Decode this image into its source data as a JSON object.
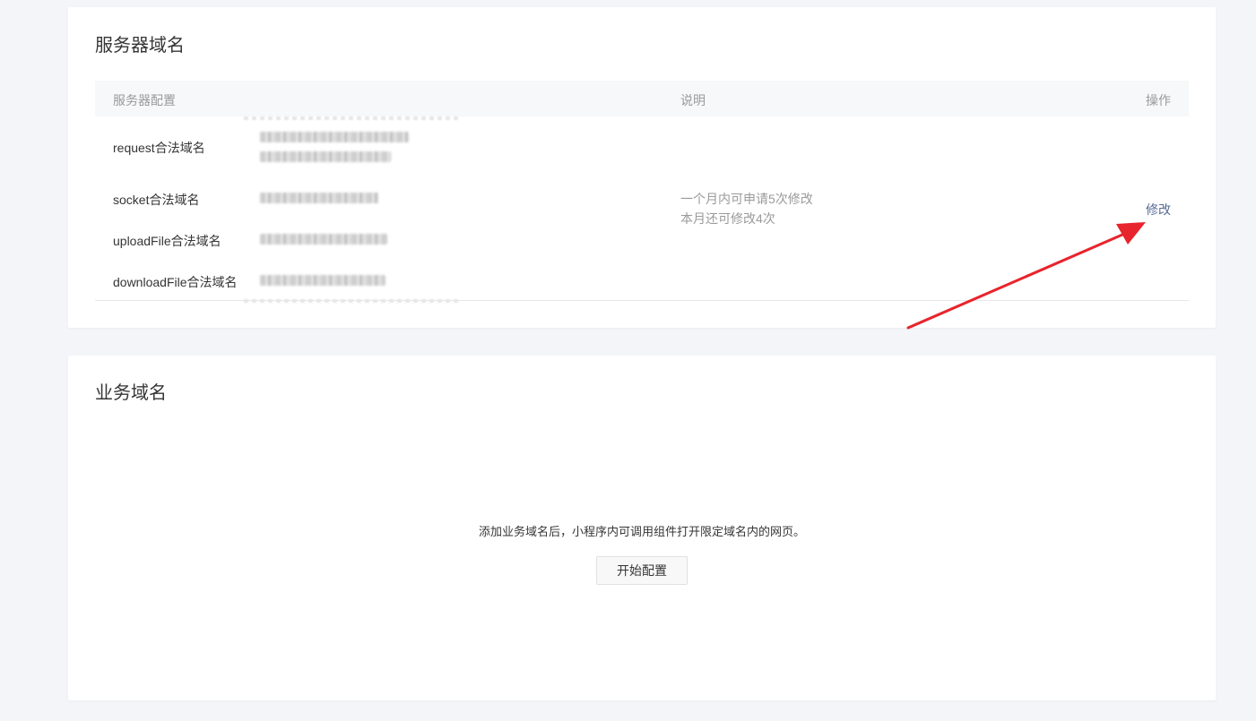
{
  "server_domain": {
    "title": "服务器域名",
    "table": {
      "headers": {
        "config": "服务器配置",
        "description": "说明",
        "operation": "操作"
      },
      "rows": [
        {
          "label": "request合法域名"
        },
        {
          "label": "socket合法域名"
        },
        {
          "label": "uploadFile合法域名"
        },
        {
          "label": "downloadFile合法域名"
        }
      ],
      "description_lines": [
        "一个月内可申请5次修改",
        "本月还可修改4次"
      ],
      "modify_label": "修改"
    }
  },
  "business_domain": {
    "title": "业务域名",
    "empty_message": "添加业务域名后，小程序内可调用组件打开限定域名内的网页。",
    "start_button_label": "开始配置"
  },
  "colors": {
    "background": "#f4f5f9",
    "card": "#ffffff",
    "link": "#576b95",
    "annotation_arrow": "#e8242c"
  }
}
